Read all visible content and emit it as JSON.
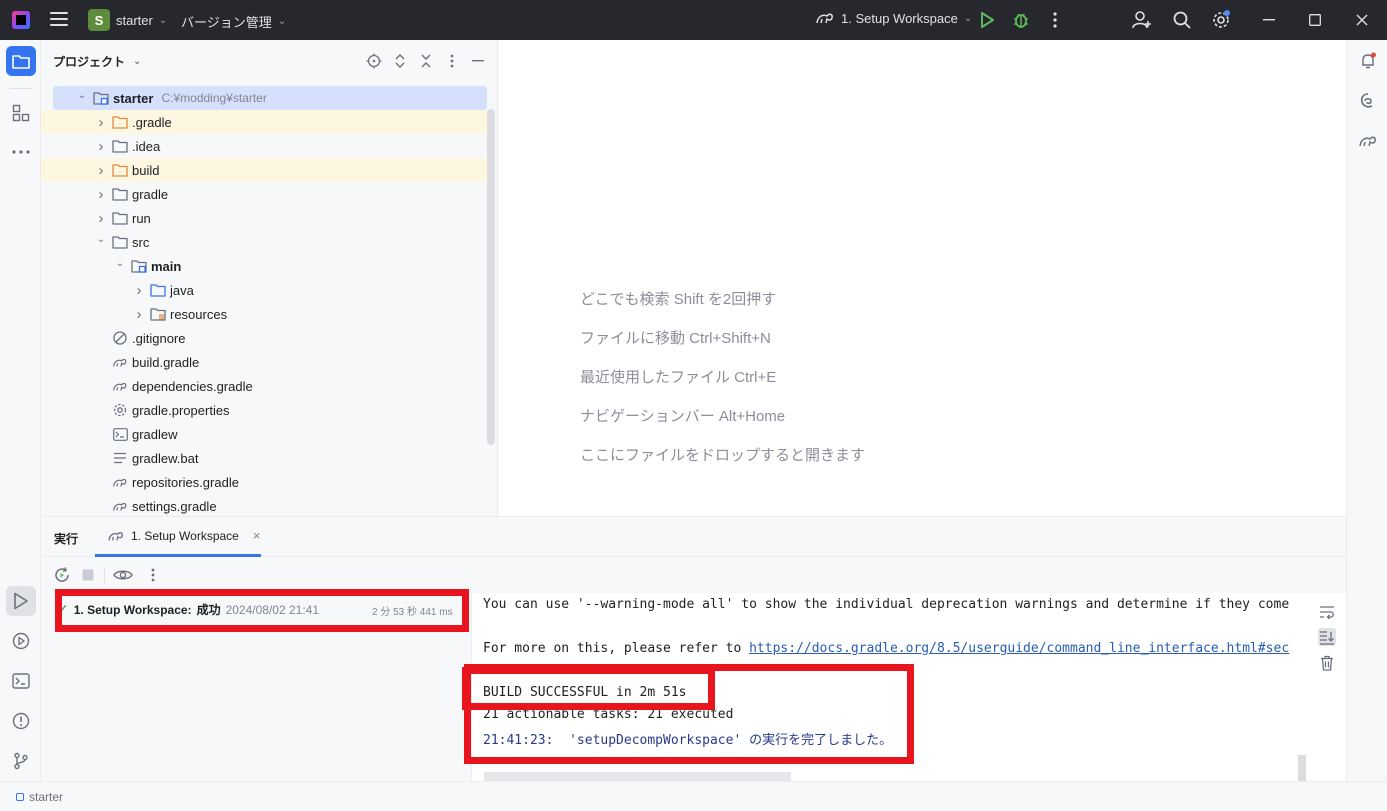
{
  "titlebar": {
    "project_badge": "S",
    "project_name": "starter",
    "vcs_label": "バージョン管理",
    "run_config": "1. Setup Workspace"
  },
  "project_panel": {
    "title": "プロジェクト",
    "tree": [
      {
        "label": "starter",
        "path": "C:¥modding¥starter",
        "depth": 0,
        "expanded": true,
        "icon": "module-folder-icon",
        "bold": true,
        "selected": true
      },
      {
        "label": ".gradle",
        "depth": 1,
        "expanded": false,
        "icon": "folder-excluded-icon",
        "excluded": true
      },
      {
        "label": ".idea",
        "depth": 1,
        "expanded": false,
        "icon": "folder-icon"
      },
      {
        "label": "build",
        "depth": 1,
        "expanded": false,
        "icon": "folder-excluded-icon",
        "excluded": true
      },
      {
        "label": "gradle",
        "depth": 1,
        "expanded": false,
        "icon": "folder-icon"
      },
      {
        "label": "run",
        "depth": 1,
        "expanded": false,
        "icon": "folder-icon"
      },
      {
        "label": "src",
        "depth": 1,
        "expanded": true,
        "icon": "folder-icon"
      },
      {
        "label": "main",
        "depth": 2,
        "expanded": true,
        "icon": "module-folder-icon",
        "bold": true
      },
      {
        "label": "java",
        "depth": 3,
        "expanded": false,
        "icon": "source-folder-icon"
      },
      {
        "label": "resources",
        "depth": 3,
        "expanded": false,
        "icon": "resources-folder-icon"
      },
      {
        "label": ".gitignore",
        "depth": 1,
        "icon": "gitignore-icon"
      },
      {
        "label": "build.gradle",
        "depth": 1,
        "icon": "gradle-file-icon"
      },
      {
        "label": "dependencies.gradle",
        "depth": 1,
        "icon": "gradle-file-icon"
      },
      {
        "label": "gradle.properties",
        "depth": 1,
        "icon": "properties-file-icon"
      },
      {
        "label": "gradlew",
        "depth": 1,
        "icon": "shell-script-icon"
      },
      {
        "label": "gradlew.bat",
        "depth": 1,
        "icon": "text-file-icon"
      },
      {
        "label": "repositories.gradle",
        "depth": 1,
        "icon": "gradle-file-icon"
      },
      {
        "label": "settings.gradle",
        "depth": 1,
        "icon": "gradle-file-icon"
      }
    ]
  },
  "editor": {
    "hints": [
      "どこでも検索 Shift を2回押す",
      "ファイルに移動 Ctrl+Shift+N",
      "最近使用したファイル Ctrl+E",
      "ナビゲーションバー Alt+Home",
      "ここにファイルをドロップすると開きます"
    ]
  },
  "run_window": {
    "title": "実行",
    "tab_label": "1. Setup Workspace",
    "tree_node": {
      "label": "1. Setup Workspace:",
      "status": "成功",
      "date": "2024/08/02 21:41",
      "duration": "2 分 53 秒 441 ms"
    },
    "console": {
      "line1": "You can use '--warning-mode all' to show the individual deprecation warnings and determine if they come",
      "line2_prefix": "For more on this, please refer to ",
      "line2_link": "https://docs.gradle.org/8.5/userguide/command_line_interface.html#sec",
      "build_result": "BUILD SUCCESSFUL in 2m 51s",
      "tasks": "21 actionable tasks: 21 executed",
      "finish_prefix": "21:41:23:  'setupDecompWorkspace' ",
      "finish_suffix": "の実行を完了しました。"
    }
  },
  "statusbar": {
    "label": "starter"
  },
  "colors": {
    "accent": "#3574f0",
    "titlebar_bg": "#27282e",
    "annotation_red": "#e8141e",
    "success_green": "#3e8c4a"
  }
}
